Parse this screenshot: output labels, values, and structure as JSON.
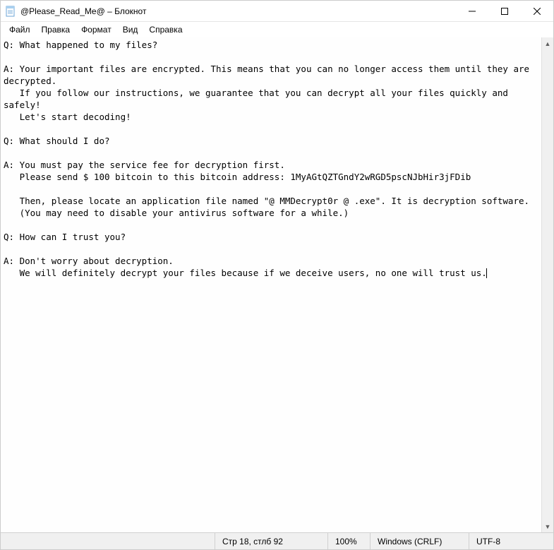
{
  "window": {
    "title": "@Please_Read_Me@ – Блокнот"
  },
  "menubar": {
    "file": "Файл",
    "edit": "Правка",
    "format": "Формат",
    "view": "Вид",
    "help": "Справка"
  },
  "document": {
    "text": "Q: What happened to my files?\n\nA: Your important files are encrypted. This means that you can no longer access them until they are decrypted.\n   If you follow our instructions, we guarantee that you can decrypt all your files quickly and safely!\n   Let's start decoding!\n\nQ: What should I do?\n\nA: You must pay the service fee for decryption first.\n   Please send $ 100 bitcoin to this bitcoin address: 1MyAGtQZTGndY2wRGD5pscNJbHir3jFDib\n\n   Then, please locate an application file named \"@ MMDecrypt0r @ .exe\". It is decryption software.\n   (You may need to disable your antivirus software for a while.)\n\nQ: How can I trust you?\n\nA: Don't worry about decryption.\n   We will definitely decrypt your files because if we deceive users, no one will trust us."
  },
  "statusbar": {
    "position": "Стр 18, стлб 92",
    "zoom": "100%",
    "line_ending": "Windows (CRLF)",
    "encoding": "UTF-8"
  }
}
